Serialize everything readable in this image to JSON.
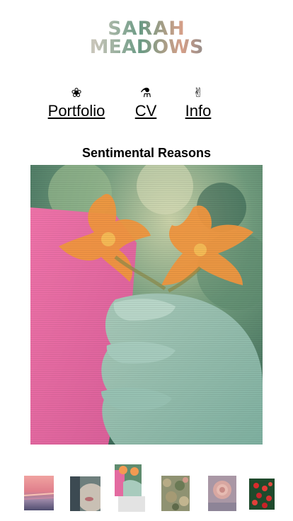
{
  "site": {
    "logo_line1": "SARAH",
    "logo_line2": "MEADOWS"
  },
  "nav": {
    "items": [
      {
        "label": "Portfolio",
        "icon": "flower-icon",
        "glyph": "❀"
      },
      {
        "label": "CV",
        "icon": "flask-icon",
        "glyph": "⚗"
      },
      {
        "label": "Info",
        "icon": "peace-hand-icon",
        "glyph": "✌"
      }
    ]
  },
  "page": {
    "title": "Sentimental Reasons"
  },
  "gallery": {
    "selected_index": 2,
    "thumbnails": [
      {
        "name": "thumb-pink-sky"
      },
      {
        "name": "thumb-face-closeup"
      },
      {
        "name": "thumb-hand-flowers"
      },
      {
        "name": "thumb-foliage"
      },
      {
        "name": "thumb-rose"
      },
      {
        "name": "thumb-red-berries"
      }
    ]
  },
  "colors": {
    "background": "#ffffff",
    "text": "#000000",
    "pink": "#e36aa0",
    "orange": "#f29a52",
    "teal_green": "#5f9c86"
  }
}
